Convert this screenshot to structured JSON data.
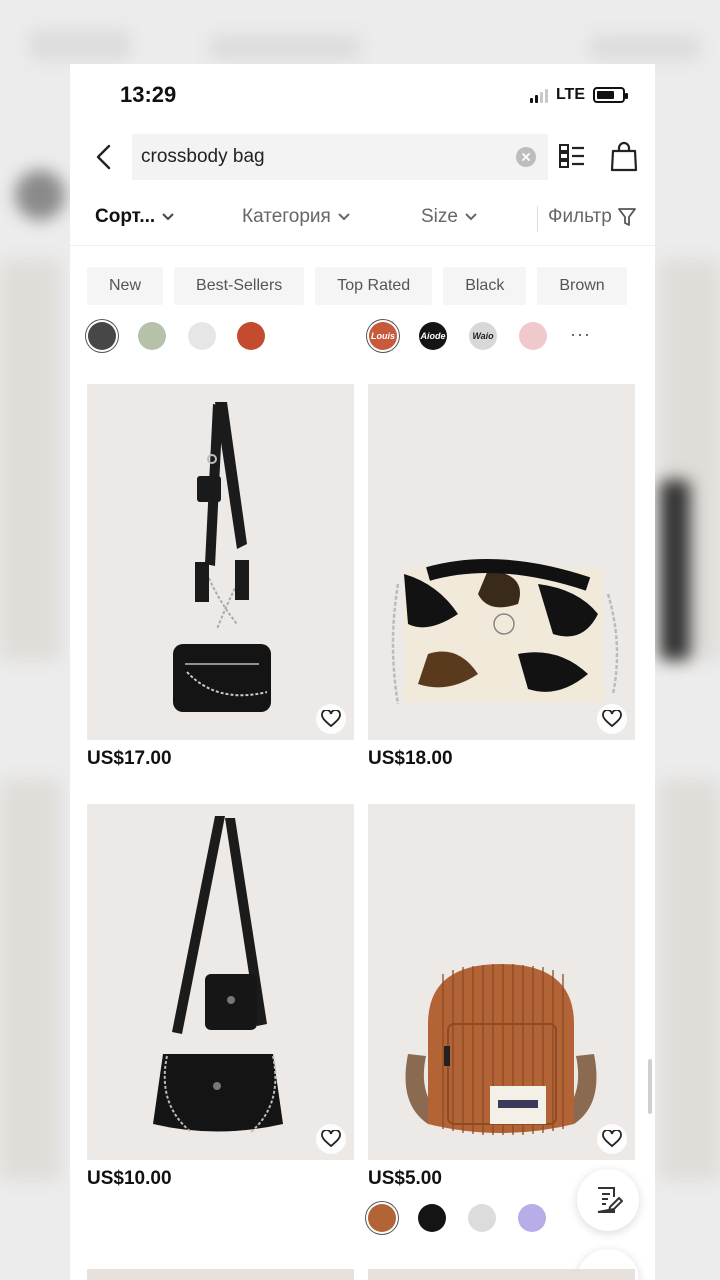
{
  "status_bar": {
    "time": "13:29",
    "network": "LTE"
  },
  "search": {
    "query": "crossbody bag",
    "icons": [
      "back-icon",
      "clear-icon",
      "list-view-icon",
      "shopping-bag-icon"
    ]
  },
  "filters": {
    "sort_label": "Сорт...",
    "category_label": "Категория",
    "size_label": "Size",
    "filter_label": "Фильтр"
  },
  "chips": [
    "New",
    "Best-Sellers",
    "Top Rated",
    "Black",
    "Brown"
  ],
  "swatches": [
    {
      "color": "#474747",
      "label": ""
    },
    {
      "color": "#b5c1a8",
      "label": ""
    },
    {
      "color": "#e6e6e6",
      "label": ""
    },
    {
      "color": "#c24c2d",
      "label": ""
    },
    {
      "color": "#c65a3a",
      "label": "Louis"
    },
    {
      "color": "#151515",
      "label": "Aiode"
    },
    {
      "color": "#d8d8d8",
      "label": "Waio"
    },
    {
      "color": "#efc9cb",
      "label": ""
    }
  ],
  "products": [
    {
      "price": "US$17.00",
      "image": "black-multi-pouch-crossbody"
    },
    {
      "price": "US$18.00",
      "image": "cow-print-chain-flap"
    },
    {
      "price": "US$10.00",
      "image": "black-chain-baguette"
    },
    {
      "price": "US$5.00",
      "image": "brown-corduroy-mini-backpack"
    }
  ],
  "product_swatches": [
    "#b36436",
    "#141414",
    "#dcdcdc",
    "#b8ade6"
  ],
  "brand_accent": "#111111"
}
